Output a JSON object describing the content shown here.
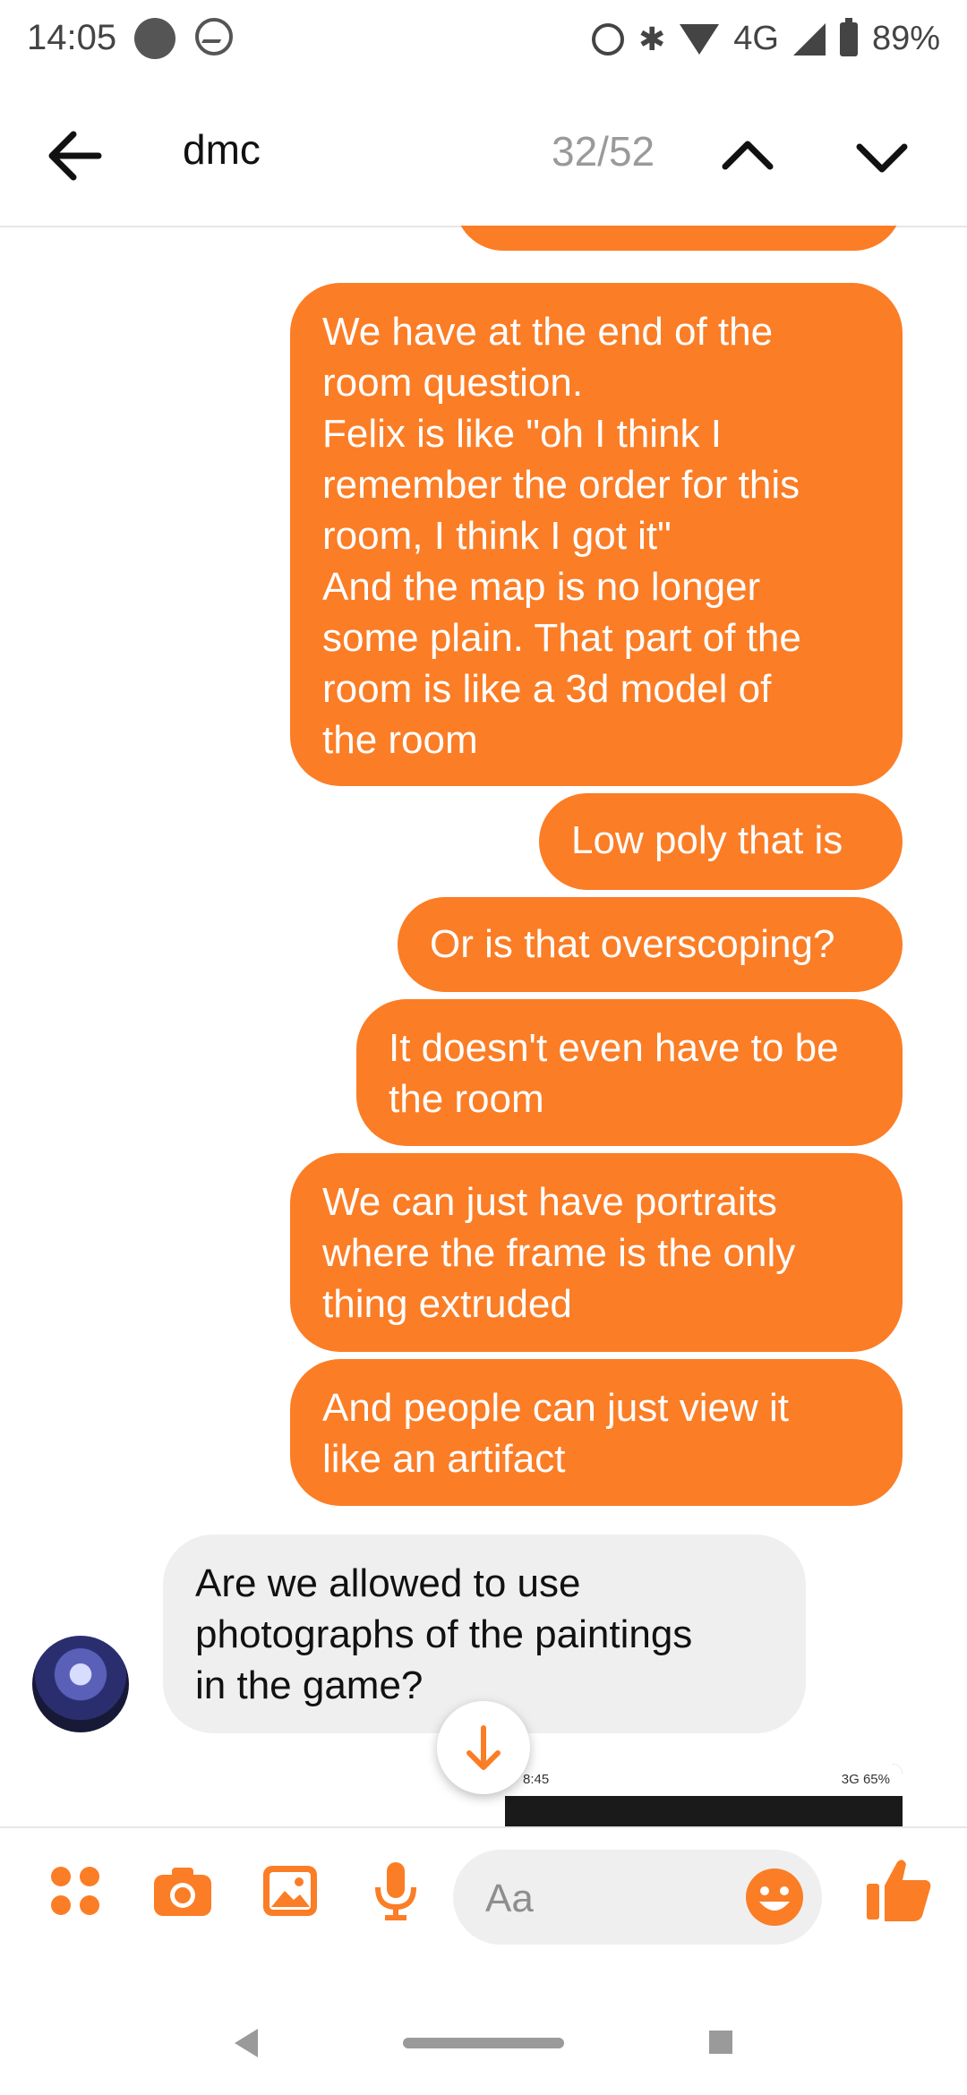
{
  "status_bar": {
    "time": "14:05",
    "network": "4G",
    "battery": "89%"
  },
  "header": {
    "title": "dmc",
    "counter": "32/52"
  },
  "messages": [
    {
      "direction": "out",
      "text": "We have at the end of the\nroom question.\nFelix is like \"oh I think I\nremember the order for this\nroom, I think I got it\"\nAnd the map is no longer\nsome plain. That part of the\nroom is like a 3d model of\nthe room"
    },
    {
      "direction": "out",
      "text": "Low poly that is"
    },
    {
      "direction": "out",
      "text": "Or is that overscoping?"
    },
    {
      "direction": "out",
      "text": "It doesn't even have to be\nthe room"
    },
    {
      "direction": "out",
      "text": "We can just have portraits\nwhere the frame is the only\nthing extruded"
    },
    {
      "direction": "out",
      "text": "And people can just view it\nlike an artifact"
    },
    {
      "direction": "in",
      "text": "Are we allowed to use\nphotographs of the paintings\nin the game?"
    }
  ],
  "preview": {
    "time": "8:45",
    "status": "3G",
    "battery": "65%"
  },
  "composer": {
    "placeholder": "Aa"
  },
  "colors": {
    "accent": "#fb7d26",
    "incoming_bubble": "#efefef"
  },
  "icons": [
    "back-arrow-icon",
    "chevron-up-icon",
    "chevron-down-icon",
    "apps-icon",
    "camera-icon",
    "gallery-icon",
    "microphone-icon",
    "emoji-icon",
    "thumbs-up-icon",
    "arrow-down-icon"
  ]
}
